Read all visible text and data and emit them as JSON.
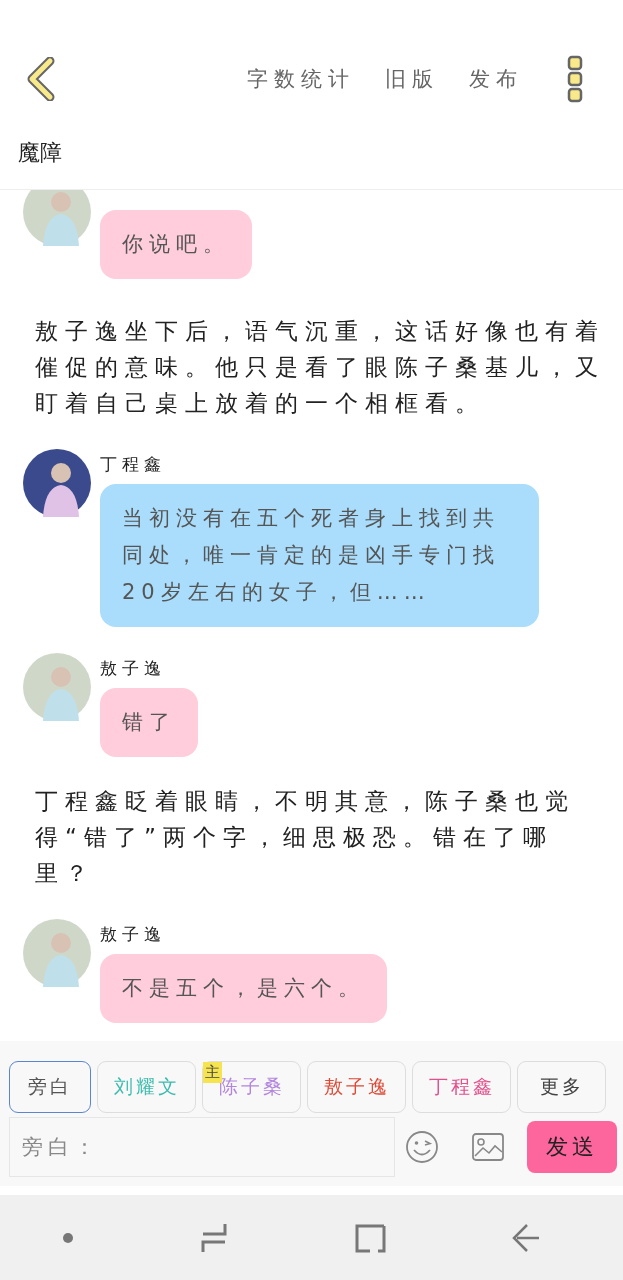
{
  "header": {
    "actions": [
      "字数统计",
      "旧版",
      "发布"
    ]
  },
  "title": "魔障",
  "chat": [
    {
      "kind": "message",
      "text": "你说吧。",
      "color": "#ffcddb"
    },
    {
      "kind": "narration",
      "text": "敖子逸坐下后，语气沉重，这话好像也有着催促的意味。他只是看了眼陈子桑基儿，又盯着自己桌上放着的一个相框看。"
    },
    {
      "kind": "message",
      "name": "丁程鑫",
      "text": "当初没有在五个死者身上找到共同处，唯一肯定的是凶手专门找20岁左右的女子，但……",
      "color": "#a9ddfb"
    },
    {
      "kind": "message",
      "name": "敖子逸",
      "text": "错了",
      "color": "#ffcddb"
    },
    {
      "kind": "narration",
      "text": "丁程鑫眨着眼睛，不明其意，陈子桑也觉得“错了”两个字，细思极恐。错在了哪里？"
    },
    {
      "kind": "message",
      "name": "敖子逸",
      "text": "不是五个，是六个。",
      "color": "#ffcddb"
    }
  ],
  "roles": [
    {
      "label": "旁白",
      "selected": true,
      "color": "#555555"
    },
    {
      "label": "刘耀文",
      "selected": false,
      "color": "#3cbcae"
    },
    {
      "label": "陈子桑",
      "selected": false,
      "color": "#b286dc",
      "badge": "主"
    },
    {
      "label": "敖子逸",
      "selected": false,
      "color": "#de4a36"
    },
    {
      "label": "丁程鑫",
      "selected": false,
      "color": "#e0508c"
    }
  ],
  "more": "更多",
  "input": {
    "placeholder": "旁白："
  },
  "send": "发送"
}
